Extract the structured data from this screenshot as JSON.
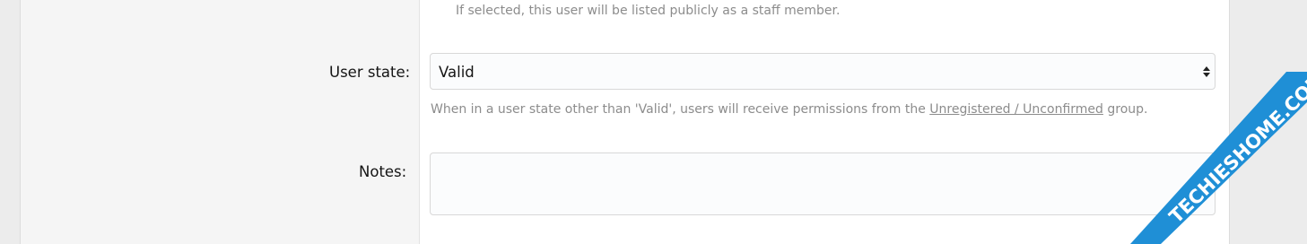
{
  "staff_hint": "If selected, this user will be listed publicly as a staff member.",
  "user_state": {
    "label": "User state:",
    "value": "Valid",
    "hint_before": "When in a user state other than 'Valid', users will receive permissions from the ",
    "hint_link": "Unregistered / Unconfirmed",
    "hint_after": " group."
  },
  "notes": {
    "label": "Notes:",
    "value": ""
  },
  "watermark": {
    "text": "TECHIESHOME.COM",
    "color": "#1f8fd6"
  }
}
